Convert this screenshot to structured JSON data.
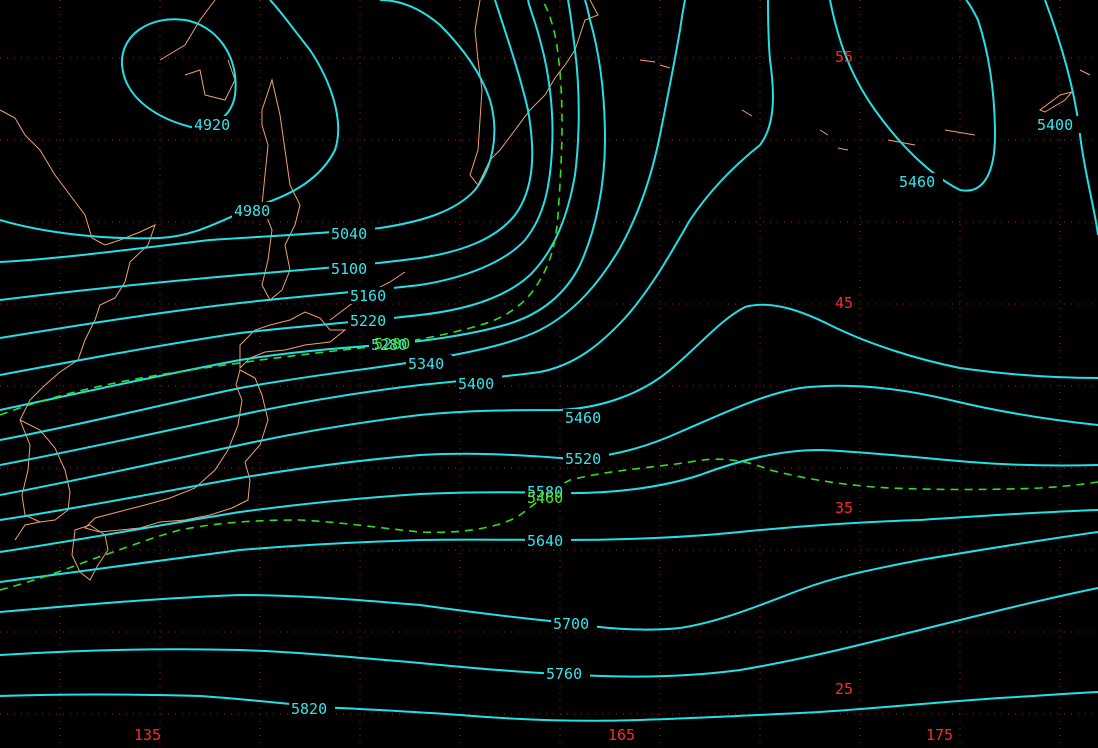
{
  "colors": {
    "background": "#000000",
    "height_contour": "#22e0e6",
    "dashed_contour": "#33dd22",
    "coastline": "#f0a070",
    "grid_and_labels": "#ff2828"
  },
  "contours": [
    {
      "id": "c4920",
      "label": "4920"
    },
    {
      "id": "c4980",
      "label": "4980"
    },
    {
      "id": "c5040",
      "label": "5040"
    },
    {
      "id": "c5100",
      "label": "5100"
    },
    {
      "id": "c5160",
      "label": "5160"
    },
    {
      "id": "c5220",
      "label": "5220"
    },
    {
      "id": "c5280",
      "label": "5280"
    },
    {
      "id": "c5340",
      "label": "5340"
    },
    {
      "id": "c5400",
      "label": "5400"
    },
    {
      "id": "c5400b",
      "label": "5400"
    },
    {
      "id": "c5460",
      "label": "5460"
    },
    {
      "id": "c5460b",
      "label": "5460"
    },
    {
      "id": "c5520",
      "label": "5520"
    },
    {
      "id": "c5580",
      "label": "5580"
    },
    {
      "id": "c5640",
      "label": "5640"
    },
    {
      "id": "c5700",
      "label": "5700"
    },
    {
      "id": "c5760",
      "label": "5760"
    },
    {
      "id": "c5820",
      "label": "5820"
    }
  ],
  "dashed_contours": [
    {
      "id": "d5280",
      "label": "5280"
    },
    {
      "id": "d5460",
      "label": "5460"
    }
  ],
  "lat_labels": [
    "55",
    "45",
    "35",
    "25"
  ],
  "lon_labels": [
    "135",
    "165",
    "175"
  ]
}
